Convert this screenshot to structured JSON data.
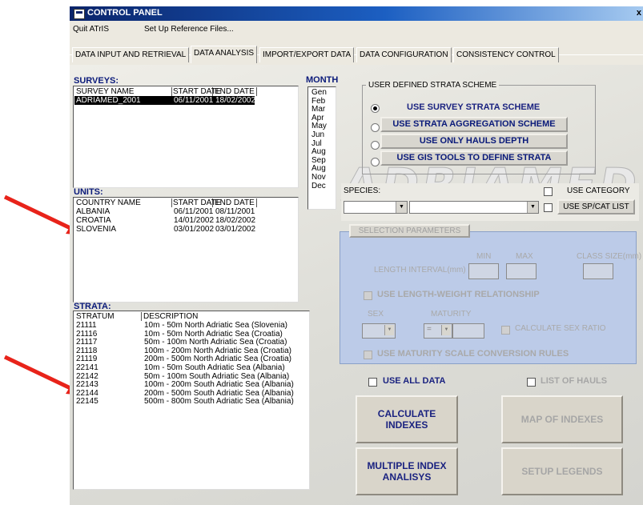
{
  "window": {
    "title": "CONTROL PANEL",
    "close": "x"
  },
  "menu": {
    "items": [
      "Quit ATrIS",
      "Set Up Reference Files..."
    ]
  },
  "tabs": [
    "DATA INPUT AND RETRIEVAL",
    "DATA ANALYSIS",
    "IMPORT/EXPORT DATA",
    "DATA CONFIGURATION",
    "CONSISTENCY CONTROL"
  ],
  "logo_text": "ADRIAMED",
  "surveys": {
    "title": "SURVEYS:",
    "headers": [
      "SURVEY NAME",
      "START DATE",
      "END DATE"
    ],
    "rows": [
      {
        "name": "ADRIAMED_2001",
        "start": "06/11/2001",
        "end": "18/02/2002"
      }
    ]
  },
  "month": {
    "title": "MONTH",
    "items": [
      "Gen",
      "Feb",
      "Mar",
      "Apr",
      "May",
      "Jun",
      "Jul",
      "Aug",
      "Sep",
      "Aug",
      "Nov",
      "Dec"
    ]
  },
  "units": {
    "title": "UNITS:",
    "headers": [
      "COUNTRY NAME",
      "START DATE",
      "END DATE"
    ],
    "rows": [
      {
        "name": "ALBANIA",
        "start": "06/11/2001",
        "end": "08/11/2001"
      },
      {
        "name": "CROATIA",
        "start": "14/01/2002",
        "end": "18/02/2002"
      },
      {
        "name": "SLOVENIA",
        "start": "03/01/2002",
        "end": "03/01/2002"
      }
    ]
  },
  "strata": {
    "title": "STRATA:",
    "headers": [
      "STRATUM",
      "DESCRIPTION"
    ],
    "rows": [
      {
        "code": "21111",
        "desc": "10m - 50m North Adriatic Sea (Slovenia)"
      },
      {
        "code": "21116",
        "desc": "10m - 50m North Adriatic Sea (Croatia)"
      },
      {
        "code": "21117",
        "desc": "50m - 100m North Adriatic Sea (Croatia)"
      },
      {
        "code": "21118",
        "desc": "100m - 200m North Adriatic Sea (Croatia)"
      },
      {
        "code": "21119",
        "desc": "200m - 500m North Adriatic Sea (Croatia)"
      },
      {
        "code": "22141",
        "desc": "10m - 50m South Adriatic Sea (Albania)"
      },
      {
        "code": "22142",
        "desc": "50m - 100m South Adriatic Sea (Albania)"
      },
      {
        "code": "22143",
        "desc": "100m - 200m South Adriatic Sea (Albania)"
      },
      {
        "code": "22144",
        "desc": "200m - 500m South Adriatic Sea (Albania)"
      },
      {
        "code": "22145",
        "desc": "500m - 800m South Adriatic Sea (Albania)"
      }
    ]
  },
  "strata_scheme": {
    "title": "USER DEFINED STRATA SCHEME",
    "options": [
      {
        "label": "USE SURVEY STRATA SCHEME",
        "selected": true
      },
      {
        "label": "USE STRATA AGGREGATION SCHEME",
        "selected": false
      },
      {
        "label": "USE ONLY HAULS DEPTH",
        "selected": false
      },
      {
        "label": "USE GIS TOOLS TO DEFINE STRATA",
        "selected": false
      }
    ]
  },
  "species": {
    "label": "SPECIES:",
    "use_category": "USE CATEGORY",
    "use_spcat_list": "USE SP/CAT LIST"
  },
  "selection": {
    "button": "SELECTION PARAMETERS",
    "min": "MIN",
    "max": "MAX",
    "class_size": "CLASS SIZE(mm)",
    "length_interval": "LENGTH INTERVAL(mm)",
    "use_lw": "USE LENGTH-WEIGHT  RELATIONSHIP",
    "sex": "SEX",
    "maturity": "MATURITY",
    "maturity_value": "=",
    "calc_sex_ratio": "CALCULATE SEX RATIO",
    "use_maturity_scale": "USE MATURITY SCALE CONVERSION RULES"
  },
  "options": {
    "use_all_data": "USE ALL DATA",
    "list_of_hauls": "LIST OF HAULS"
  },
  "buttons": {
    "calculate": [
      "CALCULATE",
      "INDEXES"
    ],
    "map": "MAP OF INDEXES",
    "multiple": [
      "MULTIPLE INDEX",
      "ANALISYS"
    ],
    "legends": "SETUP LEGENDS"
  },
  "colors": {
    "title_bar": "#0a246a",
    "selection_panel": "#bccbe8",
    "arrow": "#e8231a",
    "button_text": "#1a2280"
  }
}
